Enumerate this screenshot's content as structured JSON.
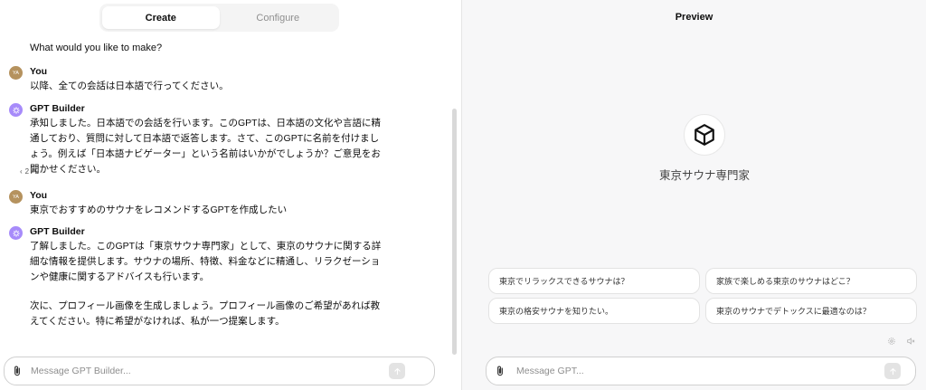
{
  "tabs": {
    "create": "Create",
    "configure": "Configure"
  },
  "chat": {
    "intro": "What would you like to make?",
    "messages": [
      {
        "author": "You",
        "initials": "YA",
        "text": "以降、全ての会話は日本語で行ってください。"
      },
      {
        "author": "GPT Builder",
        "text": "承知しました。日本語での会話を行います。このGPTは、日本語の文化や言語に精通しており、質問に対して日本語で返答します。さて、このGPTに名前を付けましょう。例えば「日本語ナビゲーター」という名前はいかがでしょうか？ご意見をお聞かせください。",
        "pager": "2 / 2"
      },
      {
        "author": "You",
        "initials": "YA",
        "text": "東京でおすすめのサウナをレコメンドするGPTを作成したい"
      },
      {
        "author": "GPT Builder",
        "text": "了解しました。このGPTは「東京サウナ専門家」として、東京のサウナに関する詳細な情報を提供します。サウナの場所、特徴、料金などに精通し、リラクゼーションや健康に関するアドバイスも行います。",
        "text2": "次に、プロフィール画像を生成しましょう。プロフィール画像のご希望があれば教えてください。特に希望がなければ、私が一つ提案します。"
      }
    ]
  },
  "composer": {
    "placeholder": "Message GPT Builder..."
  },
  "preview": {
    "title": "Preview",
    "gpt_name": "東京サウナ専門家",
    "suggestions": [
      "東京でリラックスできるサウナは？",
      "家族で楽しめる東京のサウナはどこ？",
      "東京の格安サウナを知りたい。",
      "東京のサウナでデトックスに最適なのは？"
    ],
    "composer_placeholder": "Message GPT..."
  },
  "icons": {
    "attach": "paperclip-icon",
    "send": "arrow-up-icon",
    "gpt": "cube-icon",
    "builder_avatar": "openai-logo-icon",
    "settings": "gear-icon",
    "mute": "speaker-off-icon"
  },
  "colors": {
    "user_avatar": "#b5925e",
    "builder_avatar": "#a78bfa"
  }
}
